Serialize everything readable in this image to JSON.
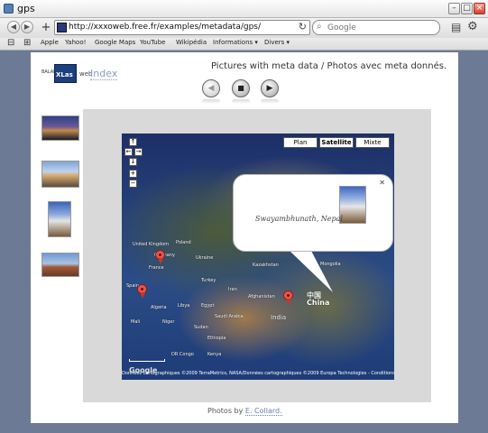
{
  "window": {
    "title": "gps"
  },
  "toolbar": {
    "url": "http://xxxoweb.free.fr/examples/metadata/gps/",
    "search_placeholder": "Google"
  },
  "bookmarks": [
    "Apple",
    "Yahoo!",
    "Google Maps",
    "YouTube",
    "Wikipédia",
    "Informations ▾",
    "Divers ▾"
  ],
  "page": {
    "logo_small": "BALADE",
    "logo_brand": "XLas",
    "logo_web": "web",
    "index_link": "Index",
    "title": "Pictures with meta data / Photos avec meta donnés."
  },
  "map": {
    "types": [
      "Plan",
      "Satellite",
      "Mixte"
    ],
    "bubble_caption": "Swayambhunath, Nepal",
    "labels": {
      "united_kingdom": "United Kingdom",
      "france": "France",
      "spain": "Spain",
      "ukraine": "Ukraine",
      "kazakhstan": "Kazakhstan",
      "afghanistan": "Afghanistan",
      "china": "China",
      "china_cn": "中国",
      "india": "India",
      "algeria": "Algeria",
      "libya": "Libya",
      "egypt": "Egypt",
      "sudan": "Sudan",
      "niger": "Niger",
      "mali": "Mali",
      "ethiopia": "Ethiopia",
      "iran": "Iran",
      "saudi_arabia": "Saudi Arabia",
      "dr_congo": "DR Congo",
      "kenya": "Kenya",
      "mongolia": "Mongolia",
      "turkey": "Turkey",
      "poland": "Poland",
      "germany": "Germany"
    },
    "google": "Google",
    "attribution": "Données cartographiques ©2009 TerraMetrics, NASA/Données cartographiques ©2009 Europa Technologies - Conditions d'utilisation"
  },
  "footer": {
    "prefix": "Photos by ",
    "author": "E. Collard."
  }
}
